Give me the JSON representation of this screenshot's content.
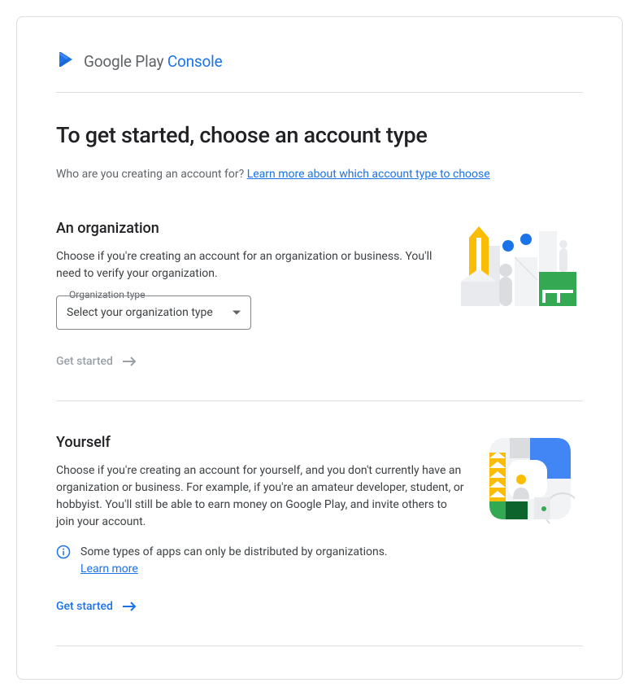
{
  "brand": {
    "name1": "Google Play",
    "name2": "Console"
  },
  "pageTitle": "To get started, choose an account type",
  "subtitlePrefix": "Who are you creating an account for? ",
  "subtitleLink": "Learn more about which account type to choose",
  "organization": {
    "title": "An organization",
    "description": "Choose if you're creating an account for an organization or business. You'll need to verify your organization.",
    "selectLabel": "Organization type",
    "selectPlaceholder": "Select your organization type",
    "getStarted": "Get started"
  },
  "yourself": {
    "title": "Yourself",
    "description": "Choose if you're creating an account for yourself, and you don't currently have an organization or business. For example, if you're an amateur developer, student, or hobbyist. You'll still be able to earn money on Google Play, and invite others to join your account.",
    "infoText": "Some types of apps can only be distributed by organizations. ",
    "infoLink": "Learn more",
    "getStarted": "Get started"
  }
}
